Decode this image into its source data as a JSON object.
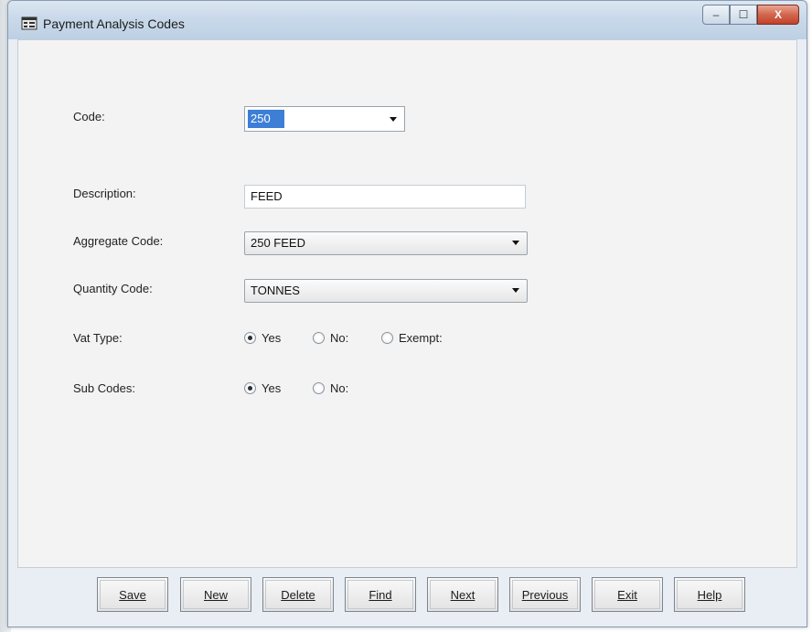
{
  "window": {
    "title": "Payment Analysis Codes",
    "controls": {
      "minimize": "–",
      "maximize": "☐",
      "close": "X"
    }
  },
  "form": {
    "code": {
      "label": "Code:",
      "value": "250"
    },
    "description": {
      "label": "Description:",
      "value": "FEED"
    },
    "aggregate_code": {
      "label": "Aggregate Code:",
      "value": "250 FEED"
    },
    "quantity_code": {
      "label": "Quantity Code:",
      "value": "TONNES"
    },
    "vat_type": {
      "label": "Vat Type:",
      "options": [
        "Yes",
        "No:",
        "Exempt:"
      ],
      "selected": "Yes"
    },
    "sub_codes": {
      "label": "Sub Codes:",
      "options": [
        "Yes",
        "No:"
      ],
      "selected": "Yes"
    }
  },
  "buttons": [
    "Save",
    "New",
    "Delete",
    "Find",
    "Next",
    "Previous",
    "Exit",
    "Help"
  ],
  "icons": {
    "app": "app-window-icon",
    "dropdown": "chevron-down-icon"
  }
}
